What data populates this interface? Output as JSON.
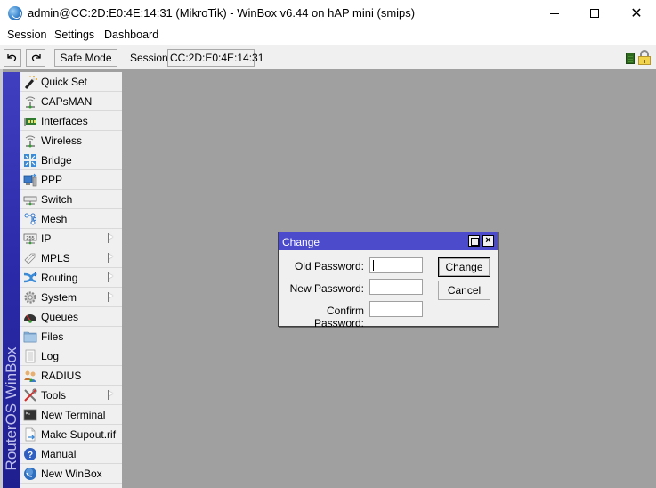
{
  "window": {
    "title": "admin@CC:2D:E0:4E:14:31 (MikroTik) - WinBox v6.44 on hAP mini (smips)",
    "controls": {
      "minimize": "minimize",
      "maximize": "maximize",
      "close": "✕"
    }
  },
  "menubar": {
    "items": [
      "Session",
      "Settings",
      "Dashboard"
    ]
  },
  "toolbar": {
    "undo_icon": "undo-icon",
    "redo_icon": "redo-icon",
    "safe_mode_label": "Safe Mode",
    "session_label": "Session:",
    "session_value": "CC:2D:E0:4E:14:31"
  },
  "sidebar": {
    "brand_text": "RouterOS WinBox",
    "items": [
      {
        "label": "Quick Set",
        "icon": "wand-icon",
        "submenu": false
      },
      {
        "label": "CAPsMAN",
        "icon": "antenna-icon",
        "submenu": false
      },
      {
        "label": "Interfaces",
        "icon": "network-card-icon",
        "submenu": false
      },
      {
        "label": "Wireless",
        "icon": "antenna-icon",
        "submenu": false
      },
      {
        "label": "Bridge",
        "icon": "bridge-icon",
        "submenu": false
      },
      {
        "label": "PPP",
        "icon": "ppp-icon",
        "submenu": false
      },
      {
        "label": "Switch",
        "icon": "switch-icon",
        "submenu": false
      },
      {
        "label": "Mesh",
        "icon": "mesh-icon",
        "submenu": false
      },
      {
        "label": "IP",
        "icon": "ip-icon",
        "submenu": true
      },
      {
        "label": "MPLS",
        "icon": "tags-icon",
        "submenu": true
      },
      {
        "label": "Routing",
        "icon": "routing-icon",
        "submenu": true
      },
      {
        "label": "System",
        "icon": "gear-icon",
        "submenu": true
      },
      {
        "label": "Queues",
        "icon": "gauge-icon",
        "submenu": false
      },
      {
        "label": "Files",
        "icon": "folder-icon",
        "submenu": false
      },
      {
        "label": "Log",
        "icon": "document-icon",
        "submenu": false
      },
      {
        "label": "RADIUS",
        "icon": "users-icon",
        "submenu": false
      },
      {
        "label": "Tools",
        "icon": "tools-icon",
        "submenu": true
      },
      {
        "label": "New Terminal",
        "icon": "terminal-icon",
        "submenu": false
      },
      {
        "label": "Make Supout.rif",
        "icon": "file-export-icon",
        "submenu": false
      },
      {
        "label": "Manual",
        "icon": "help-icon",
        "submenu": false
      },
      {
        "label": "New WinBox",
        "icon": "winbox-icon",
        "submenu": false
      }
    ]
  },
  "dialog": {
    "title": "Change",
    "fields": [
      {
        "label": "Old Password:",
        "value": ""
      },
      {
        "label": "New Password:",
        "value": ""
      },
      {
        "label": "Confirm Password:",
        "value": ""
      }
    ],
    "change_label": "Change",
    "cancel_label": "Cancel"
  },
  "colors": {
    "sidebar_brand": "#2a2aa8",
    "dialog_title": "#4b4bcc",
    "workspace": "#a0a0a0",
    "status_green": "#2d6a1d"
  }
}
